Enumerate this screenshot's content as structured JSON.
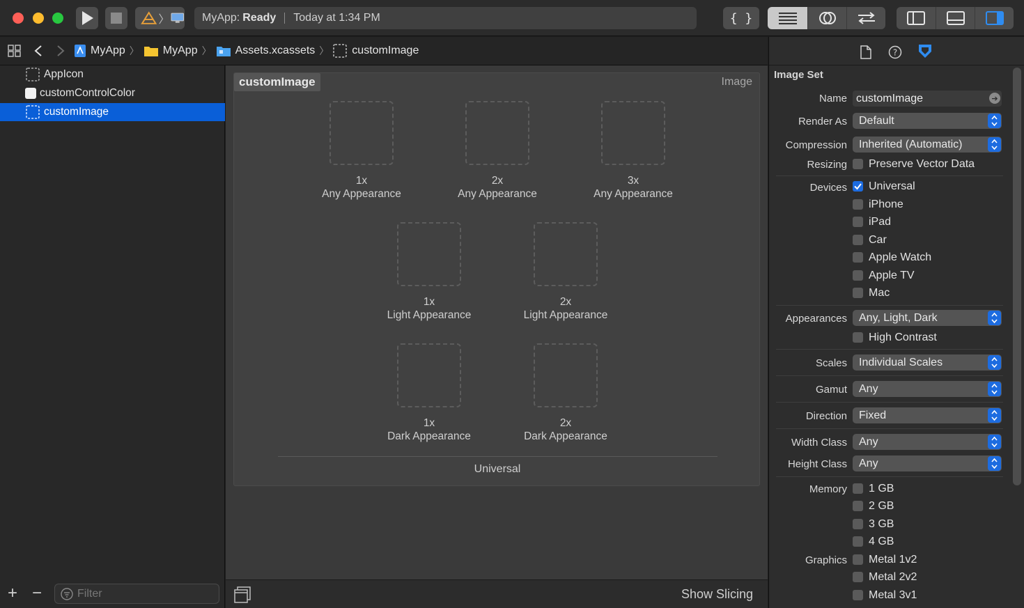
{
  "toolbar": {
    "status_app": "MyApp:",
    "status_state": "Ready",
    "status_time": "Today at 1:34 PM"
  },
  "breadcrumb": [
    "MyApp",
    "MyApp",
    "Assets.xcassets",
    "customImage"
  ],
  "navigator": {
    "items": [
      {
        "label": "AppIcon"
      },
      {
        "label": "customControlColor"
      },
      {
        "label": "customImage",
        "selected": true
      }
    ],
    "filter_placeholder": "Filter"
  },
  "editor": {
    "title": "customImage",
    "kind": "Image",
    "wells": [
      {
        "scale": "1x",
        "label": "Any Appearance"
      },
      {
        "scale": "2x",
        "label": "Any Appearance"
      },
      {
        "scale": "3x",
        "label": "Any Appearance"
      },
      {
        "scale": "1x",
        "label": "Light Appearance"
      },
      {
        "scale": "2x",
        "label": "Light Appearance"
      },
      {
        "scale": "1x",
        "label": "Dark Appearance"
      },
      {
        "scale": "2x",
        "label": "Dark Appearance"
      }
    ],
    "group_label": "Universal",
    "show_slicing": "Show Slicing"
  },
  "inspector": {
    "section": "Image Set",
    "name_label": "Name",
    "name_value": "customImage",
    "render_as_label": "Render As",
    "render_as_value": "Default",
    "compression_label": "Compression",
    "compression_value": "Inherited (Automatic)",
    "resizing_label": "Resizing",
    "preserve_vector": "Preserve Vector Data",
    "devices_label": "Devices",
    "devices": [
      {
        "label": "Universal",
        "checked": true
      },
      {
        "label": "iPhone",
        "checked": false
      },
      {
        "label": "iPad",
        "checked": false
      },
      {
        "label": "Car",
        "checked": false
      },
      {
        "label": "Apple Watch",
        "checked": false
      },
      {
        "label": "Apple TV",
        "checked": false
      },
      {
        "label": "Mac",
        "checked": false
      }
    ],
    "appearances_label": "Appearances",
    "appearances_value": "Any, Light, Dark",
    "high_contrast": "High Contrast",
    "scales_label": "Scales",
    "scales_value": "Individual Scales",
    "gamut_label": "Gamut",
    "gamut_value": "Any",
    "direction_label": "Direction",
    "direction_value": "Fixed",
    "width_class_label": "Width Class",
    "width_class_value": "Any",
    "height_class_label": "Height Class",
    "height_class_value": "Any",
    "memory_label": "Memory",
    "memory": [
      "1 GB",
      "2 GB",
      "3 GB",
      "4 GB"
    ],
    "graphics_label": "Graphics",
    "graphics": [
      "Metal 1v2",
      "Metal 2v2",
      "Metal 3v1"
    ]
  },
  "colors": {
    "selection": "#0a5fd8",
    "accent": "#1d6ce0",
    "close": "#fe5f57",
    "minimize": "#febc2e",
    "zoom": "#28c840"
  }
}
